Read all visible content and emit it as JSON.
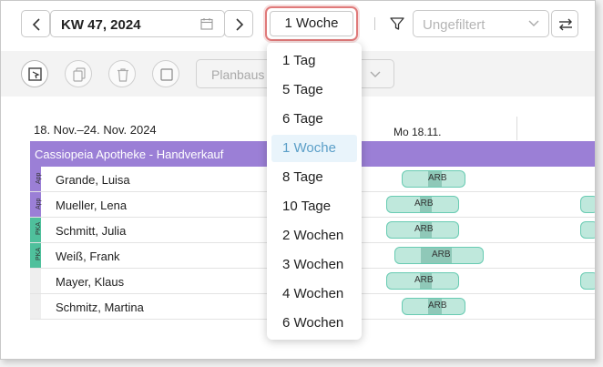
{
  "toolbar": {
    "week_label": "KW 47, 2024",
    "period_selected": "1 Woche",
    "filter_placeholder": "Ungefiltert"
  },
  "actionbar": {
    "plan_label": "Planbaus"
  },
  "schedule": {
    "range_label": "18. Nov.–24. Nov. 2024",
    "day_label": "Mo 18.11.",
    "group_label": "Cassiopeia Apotheke - Handverkauf",
    "shift_label": "ARB",
    "employees": [
      {
        "name": "Grande, Luisa",
        "tag": "App",
        "tag_color": "#9b7fd6"
      },
      {
        "name": "Mueller, Lena",
        "tag": "App",
        "tag_color": "#9b7fd6"
      },
      {
        "name": "Schmitt, Julia",
        "tag": "PKA",
        "tag_color": "#4fc09c"
      },
      {
        "name": "Weiß, Frank",
        "tag": "PKA",
        "tag_color": "#4fc09c"
      },
      {
        "name": "Mayer, Klaus",
        "tag": "",
        "tag_color": "#eeeeee"
      },
      {
        "name": "Schmitz, Martina",
        "tag": "",
        "tag_color": "#eeeeee"
      }
    ]
  },
  "dropdown": {
    "options": [
      "1 Tag",
      "5 Tage",
      "6 Tage",
      "1 Woche",
      "8 Tage",
      "10 Tage",
      "2 Wochen",
      "3 Wochen",
      "4 Wochen",
      "6 Wochen"
    ],
    "selected": "1 Woche"
  },
  "colors": {
    "accent": "#5b9fc8",
    "group": "#9b7fd6",
    "shift_fill": "#bfe8dc",
    "shift_border": "#68cbb2",
    "highlight": "#e07a7a"
  }
}
